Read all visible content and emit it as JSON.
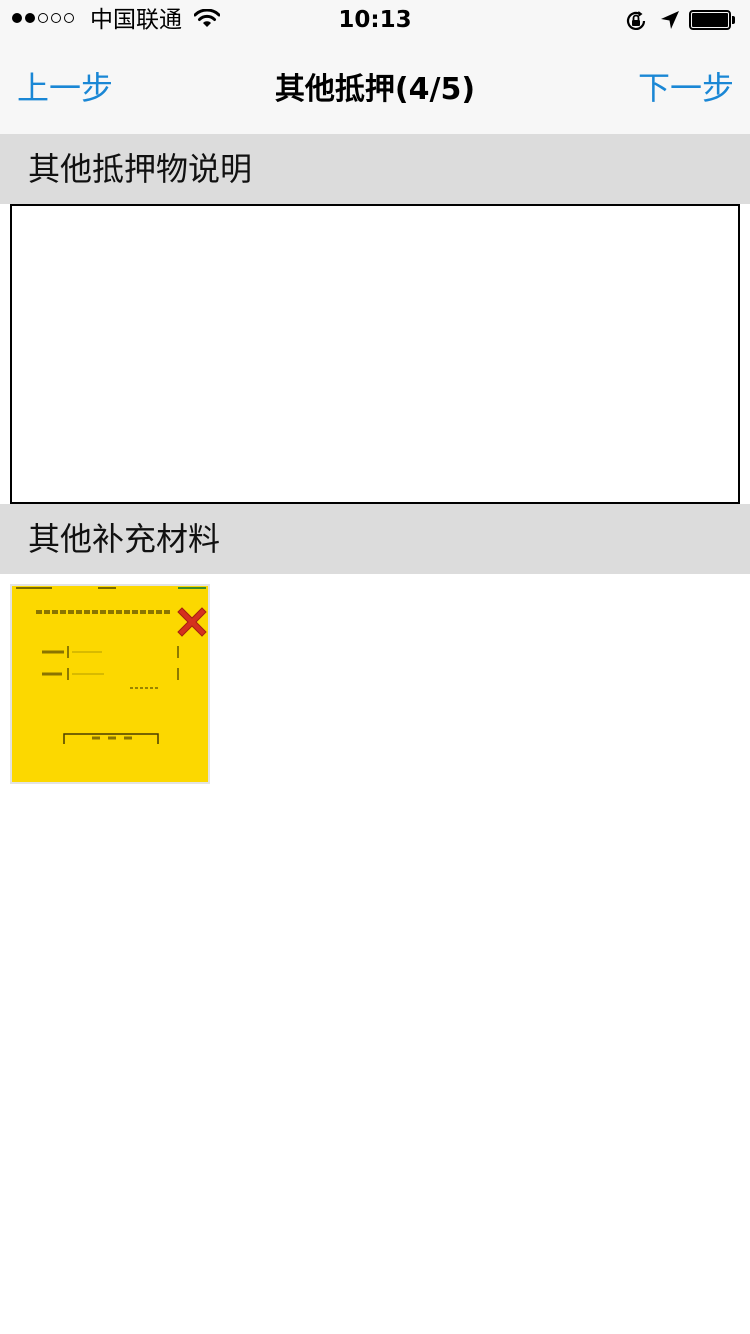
{
  "status_bar": {
    "signal_filled": 2,
    "signal_total": 5,
    "carrier": "中国联通",
    "time": "10:13"
  },
  "nav": {
    "back_label": "上一步",
    "title": "其他抵押(4/5)",
    "next_label": "下一步"
  },
  "description_section": {
    "label": "其他抵押物说明",
    "input_value": ""
  },
  "supplement_section": {
    "label": "其他补充材料",
    "attachments": [
      {
        "type": "image",
        "thumbnail_color": "#fcd800"
      }
    ]
  },
  "colors": {
    "accent": "#1a87d5",
    "section_bg": "#dcdcdc",
    "nav_bg": "#f7f7f7",
    "delete_red": "#d4311e"
  },
  "icons": [
    "wifi-icon",
    "rotation-lock-icon",
    "location-arrow-icon",
    "battery-icon",
    "delete-icon"
  ]
}
